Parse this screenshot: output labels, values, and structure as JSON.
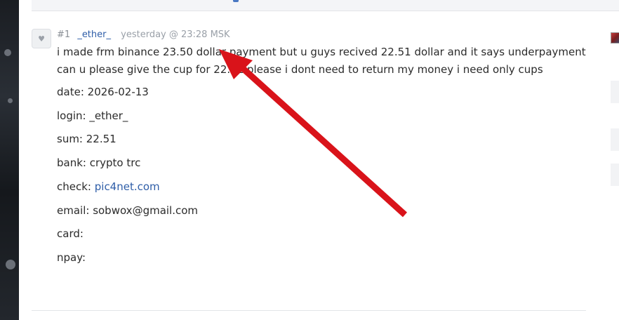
{
  "post": {
    "number": "#1",
    "author": "_ether_",
    "timestamp": "yesterday @ 23:28 MSK",
    "message": "i made frm binance 23.50 dollar payment but u guys recived 22.51 dollar and it says underpayment can u please give the cup for 22.51 please i dont need to return my money i need only cups",
    "fields": {
      "date": "date: 2026-02-13",
      "login": "login: _ether_",
      "sum": "sum: 22.51",
      "bank": "bank: crypto trc",
      "check_label": "check: ",
      "check_link": "pic4net.com",
      "email": "email: sobwox@gmail.com",
      "card": "card:",
      "npay": "npay:"
    }
  },
  "icons": {
    "avatar": "avatar-placeholder-icon",
    "annotation": "red-arrow-annotation"
  },
  "colors": {
    "link": "#2f5ea8",
    "arrow": "#d9131a",
    "text": "#2b2b2b",
    "meta": "#8a8f96"
  }
}
